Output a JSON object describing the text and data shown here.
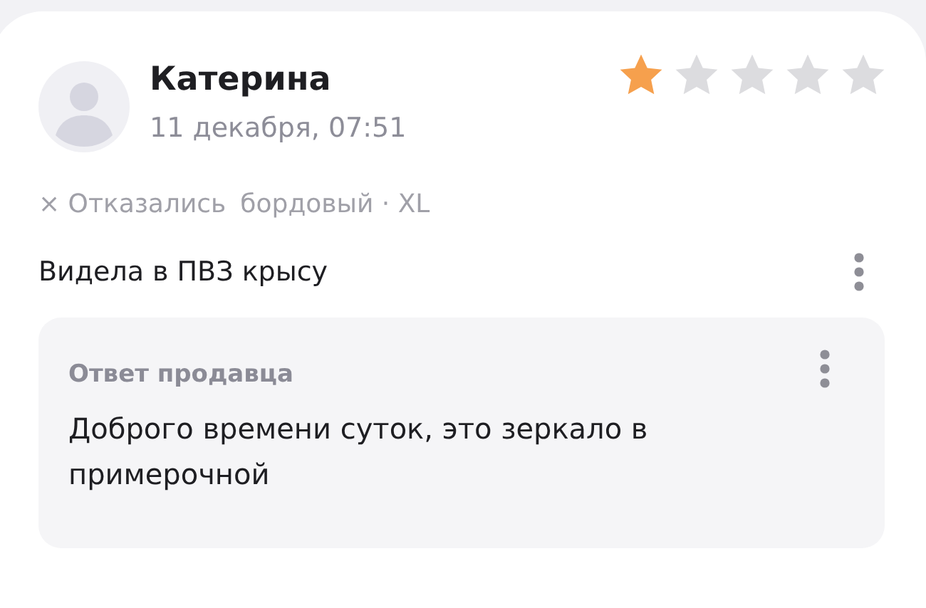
{
  "review": {
    "author": "Катерина",
    "date": "11 декабря, 07:51",
    "stars": 1,
    "tags": [
      "× Отказались",
      "бордовый · XL"
    ],
    "text": "Видела в ПВЗ крысу",
    "reply": {
      "title": "Ответ продавца",
      "text": "Доброго времени суток, это зеркало в примерочной"
    }
  }
}
